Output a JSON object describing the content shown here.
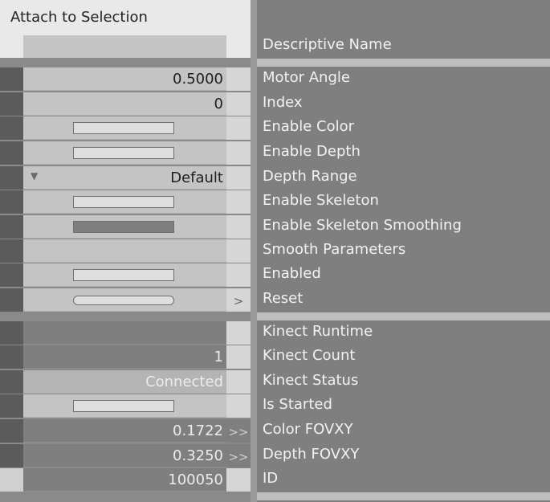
{
  "header": {
    "title": "Attach to Selection",
    "column_title": "Descriptive Name"
  },
  "icons": {
    "trigger": ">",
    "double_trigger": ">>",
    "dropdown": "▼"
  },
  "colors": {
    "panel_bg": "#8a8a8a",
    "header_bg": "#e9e9e9",
    "value_bg": "#c4c4c4",
    "toggle_on": "#7f7f7f",
    "label_text": "#f2f2f2"
  },
  "rows": [
    {
      "label": "Motor Angle",
      "kind": "number",
      "value": "0.5000"
    },
    {
      "label": "Index",
      "kind": "number",
      "value": "0"
    },
    {
      "label": "Enable Color",
      "kind": "toggle",
      "checked": false
    },
    {
      "label": "Enable Depth",
      "kind": "toggle",
      "checked": false
    },
    {
      "label": "Depth Range",
      "kind": "select",
      "value": "Default"
    },
    {
      "label": "Enable Skeleton",
      "kind": "toggle",
      "checked": false
    },
    {
      "label": "Enable Skeleton Smoothing",
      "kind": "toggle",
      "checked": true
    },
    {
      "label": "Smooth Parameters",
      "kind": "group"
    },
    {
      "label": "Enabled",
      "kind": "toggle",
      "checked": false
    },
    {
      "label": "Reset",
      "kind": "button"
    },
    {
      "label": "Kinect Runtime",
      "kind": "output"
    },
    {
      "label": "Kinect Count",
      "kind": "output",
      "value": "1"
    },
    {
      "label": "Kinect Status",
      "kind": "output",
      "value": "Connected"
    },
    {
      "label": "Is Started",
      "kind": "output-toggle",
      "checked": false
    },
    {
      "label": "Color FOVXY",
      "kind": "output",
      "value": "0.1722"
    },
    {
      "label": "Depth FOVXY",
      "kind": "output",
      "value": "0.3250"
    },
    {
      "label": "ID",
      "kind": "output",
      "value": "100050"
    }
  ]
}
